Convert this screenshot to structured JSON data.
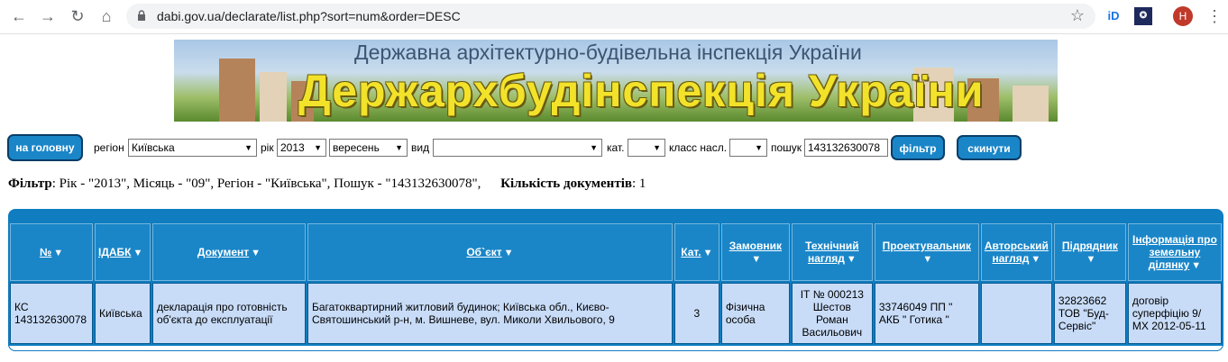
{
  "browser": {
    "url": "dabi.gov.ua/declarate/list.php?sort=num&order=DESC",
    "avatar_letter": "H"
  },
  "banner": {
    "subtitle": "Державна архітектурно-будівельна інспекція України",
    "title": "Держархбудінспекція України"
  },
  "filters": {
    "home_button": "на головну",
    "region_label": "регіон",
    "region_value": "Київська",
    "year_label": "рік",
    "year_value": "2013",
    "month_value": "вересень",
    "type_label": "вид",
    "type_value": "",
    "cat_label": "кат.",
    "cat_value": "",
    "class_label": "класс насл.",
    "class_value": "",
    "search_label": "пошук",
    "search_value": "143132630078",
    "filter_button": "фільтр",
    "reset_button": "скинути"
  },
  "summary": {
    "filter_label": "Фільтр",
    "filter_text": ": Рік - \"2013\", Місяць - \"09\", Регіон - \"Київська\", Пошук - \"143132630078\",",
    "count_label": "Кількість документів",
    "count_value": ": 1"
  },
  "table": {
    "headers": [
      "№",
      "ІДАБК",
      "Документ",
      "Об`єкт",
      "Кат.",
      "Замовник",
      "Технічний нагляд",
      "Проектувальник",
      "Авторський нагляд",
      "Підрядник",
      "Інформація про земельну ділянку"
    ],
    "rows": [
      [
        "КС 143132630078",
        "Київська",
        "декларація про готовність об'єкта до експлуатації",
        "Багатоквартирний житловий будинок; Київська обл., Києво-Святошинський р-н, м. Вишневе, вул. Миколи Хвильового, 9",
        "3",
        "Фізична особа",
        "ІТ № 000213 Шестов Роман Васильович",
        "33746049 ПП \" АКБ \" Готика \"",
        "",
        "32823662 ТОВ \"Буд-Сервіс\"",
        "договір суперфіцію 9/МХ 2012-05-11"
      ]
    ]
  },
  "colors": {
    "accent": "#1a86c8",
    "row_bg": "#c8dcf8",
    "banner_title": "#f2e22a"
  }
}
